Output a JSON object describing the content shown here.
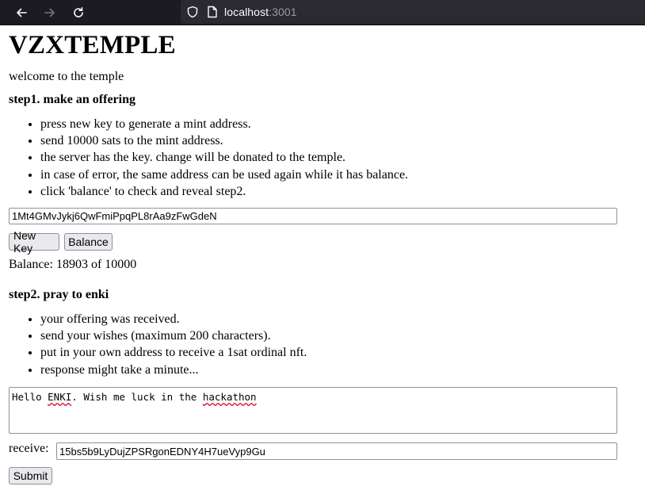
{
  "browser": {
    "url_host": "localhost",
    "url_port": ":3001"
  },
  "page": {
    "title": "VZXTEMPLE",
    "welcome": "welcome to the temple",
    "step1": {
      "heading": "step1. make an offering",
      "bullets": [
        "press new key to generate a mint address.",
        "send 10000 sats to the mint address.",
        "the server has the key. change will be donated to the temple.",
        "in case of error, the same address can be used again while it has balance.",
        "click 'balance' to check and reveal step2."
      ],
      "mint_address": "1Mt4GMvJykj6QwFmiPpqPL8rAa9zFwGdeN",
      "new_key_label": "New Key",
      "balance_label": "Balance",
      "balance_text": "Balance: 18903 of 10000"
    },
    "step2": {
      "heading": "step2. pray to enki",
      "bullets": [
        "your offering was received.",
        "send your wishes (maximum 200 characters).",
        "put in your own address to receive a 1sat ordinal nft.",
        "response might take a minute..."
      ],
      "wish_prefix": "Hello ",
      "wish_word1": "ENKI",
      "wish_middle": ". Wish me luck in the ",
      "wish_word2": "hackathon",
      "receive_label": "receive:",
      "receive_address": "15bs5b9LyDujZPSRgonEDNY4H7ueVyp9Gu",
      "submit_label": "Submit"
    }
  }
}
